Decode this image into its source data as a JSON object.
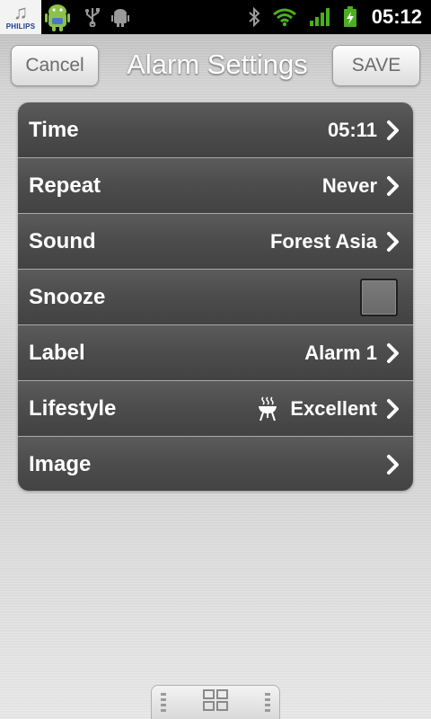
{
  "status_bar": {
    "time": "05:12",
    "philips_label": "PHILIPS",
    "icons": [
      "philips-music-icon",
      "android-app-icon",
      "usb-icon",
      "android-debug-icon",
      "bluetooth-icon",
      "wifi-icon",
      "signal-icon",
      "battery-charging-icon"
    ]
  },
  "header": {
    "title": "Alarm Settings",
    "cancel_label": "Cancel",
    "save_label": "SAVE"
  },
  "settings": {
    "rows": [
      {
        "label": "Time",
        "value": "05:11",
        "control": "chevron"
      },
      {
        "label": "Repeat",
        "value": "Never",
        "control": "chevron"
      },
      {
        "label": "Sound",
        "value": "Forest Asia",
        "control": "chevron"
      },
      {
        "label": "Snooze",
        "value": "",
        "control": "checkbox",
        "checked": false
      },
      {
        "label": "Label",
        "value": "Alarm 1",
        "control": "chevron"
      },
      {
        "label": "Lifestyle",
        "value": "Excellent",
        "control": "chevron",
        "icon": "bbq-grill-icon"
      },
      {
        "label": "Image",
        "value": "",
        "control": "chevron"
      }
    ]
  },
  "colors": {
    "row_background": "#4d4d4d",
    "text": "#ffffff",
    "status_bar": "#000000",
    "wifi": "#4caf20",
    "signal": "#4caf20",
    "battery": "#4caf20"
  }
}
